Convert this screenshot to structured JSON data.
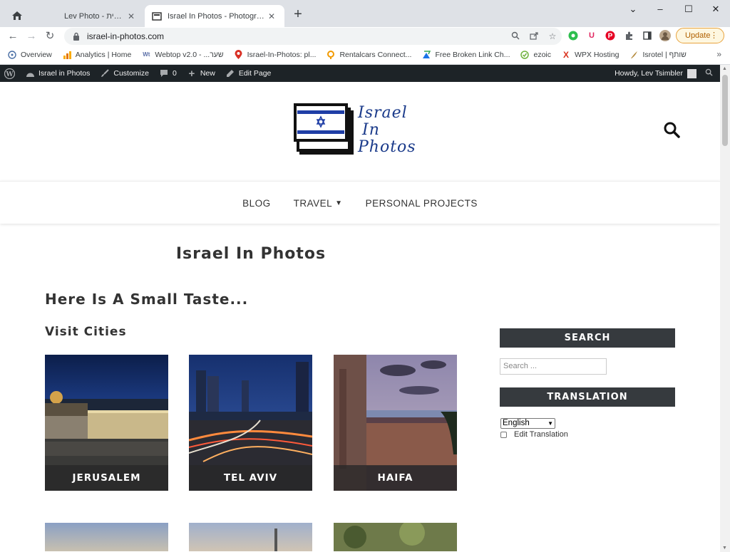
{
  "browser": {
    "tabs": [
      {
        "title": "Lev Photo - עמוד הבית",
        "active": false
      },
      {
        "title": "Israel In Photos - Photographer",
        "active": true
      }
    ],
    "new_tab_label": "+",
    "window_controls": {
      "minimize": "–",
      "maximize": "☐",
      "close": "✕"
    },
    "url": "israel-in-photos.com",
    "update_button": "Update",
    "bookmarks": [
      {
        "label": "Overview",
        "icon": "overview-icon"
      },
      {
        "label": "Analytics | Home",
        "icon": "analytics-icon"
      },
      {
        "label": "Webtop v2.0 - ...שער",
        "icon": "webtop-icon"
      },
      {
        "label": "Israel-In-Photos: pl...",
        "icon": "map-pin-icon"
      },
      {
        "label": "Rentalcars Connect...",
        "icon": "rentalcars-icon"
      },
      {
        "label": "Free Broken Link Ch...",
        "icon": "link-checker-icon"
      },
      {
        "label": "ezoic",
        "icon": "ezoic-icon"
      },
      {
        "label": "WPX Hosting",
        "icon": "wpx-icon"
      },
      {
        "label": "Isrotel | שותף",
        "icon": "isrotel-icon"
      }
    ],
    "bookmarks_more": "»",
    "accent": "#1a73e8"
  },
  "adminbar": {
    "site_name": "Israel in Photos",
    "customize": "Customize",
    "comments_count": "0",
    "new": "New",
    "edit_page": "Edit Page",
    "howdy": "Howdy, Lev Tsimbler"
  },
  "site": {
    "logo_lines": [
      "Israel",
      "In",
      "Photos"
    ],
    "menu": [
      {
        "label": "BLOG",
        "has_dropdown": false
      },
      {
        "label": "TRAVEL",
        "has_dropdown": true
      },
      {
        "label": "PERSONAL PROJECTS",
        "has_dropdown": false
      }
    ]
  },
  "main": {
    "title": "Israel In Photos",
    "subtitle": "Here Is A Small Taste...",
    "section_heading": "Visit Cities",
    "cities": [
      {
        "name": "JERUSALEM"
      },
      {
        "name": "TEL AVIV"
      },
      {
        "name": "HAIFA"
      }
    ]
  },
  "sidebar": {
    "search_title": "SEARCH",
    "search_placeholder": "Search ...",
    "translation_title": "TRANSLATION",
    "language_selected": "English",
    "edit_translation": "Edit Translation"
  }
}
